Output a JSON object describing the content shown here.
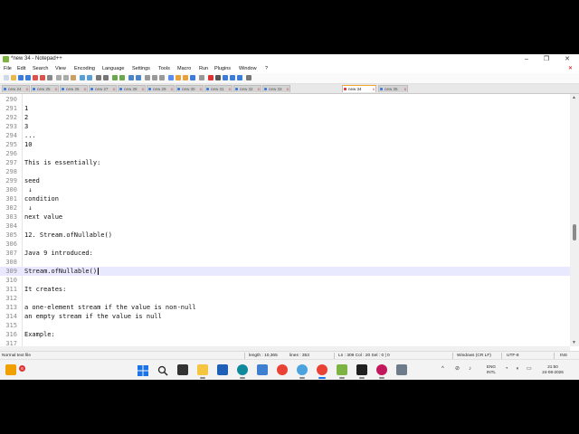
{
  "window": {
    "title": "*new 34 - Notepad++",
    "buttons": [
      "–",
      "❐",
      "✕"
    ]
  },
  "menu": [
    "File",
    "Edit",
    "Search",
    "View",
    "Encoding",
    "Language",
    "Settings",
    "Tools",
    "Macro",
    "Run",
    "Plugins",
    "Window",
    "?"
  ],
  "tabs": [
    {
      "label": "new 24",
      "active": false
    },
    {
      "label": "new 25",
      "active": false
    },
    {
      "label": "new 26",
      "active": false
    },
    {
      "label": "new 27",
      "active": false
    },
    {
      "label": "new 28",
      "active": false
    },
    {
      "label": "new 29",
      "active": false
    },
    {
      "label": "new 30",
      "active": false
    },
    {
      "label": "new 31",
      "active": false
    },
    {
      "label": "new 32",
      "active": false
    },
    {
      "label": "new 33",
      "active": false
    },
    {
      "label": "new 34",
      "active": true
    },
    {
      "label": "new 35",
      "active": false
    }
  ],
  "editor": {
    "current_line": 309,
    "lines": [
      {
        "n": "290",
        "text": ""
      },
      {
        "n": "291",
        "text": "1"
      },
      {
        "n": "292",
        "text": "2"
      },
      {
        "n": "293",
        "text": "3"
      },
      {
        "n": "294",
        "text": "..."
      },
      {
        "n": "295",
        "text": "10"
      },
      {
        "n": "296",
        "text": ""
      },
      {
        "n": "297",
        "text": "This is essentially:"
      },
      {
        "n": "298",
        "text": ""
      },
      {
        "n": "299",
        "text": "seed"
      },
      {
        "n": "300",
        "text": " ↓"
      },
      {
        "n": "301",
        "text": "condition"
      },
      {
        "n": "302",
        "text": " ↓"
      },
      {
        "n": "303",
        "text": "next value"
      },
      {
        "n": "304",
        "text": ""
      },
      {
        "n": "305",
        "text": "12. Stream.ofNullable()"
      },
      {
        "n": "306",
        "text": ""
      },
      {
        "n": "307",
        "text": "Java 9 introduced:"
      },
      {
        "n": "308",
        "text": ""
      },
      {
        "n": "309",
        "text": "Stream.ofNullable()"
      },
      {
        "n": "310",
        "text": ""
      },
      {
        "n": "311",
        "text": "It creates:"
      },
      {
        "n": "312",
        "text": ""
      },
      {
        "n": "313",
        "text": "a one-element stream if the value is non-null"
      },
      {
        "n": "314",
        "text": "an empty stream if the value is null"
      },
      {
        "n": "315",
        "text": ""
      },
      {
        "n": "316",
        "text": "Example:"
      },
      {
        "n": "317",
        "text": ""
      }
    ]
  },
  "status": {
    "filetype": "Normal text file",
    "length": "length : 10,365",
    "lines": "lines : 353",
    "position": "Ln : 309    Col : 20    Sel : 0 | 0",
    "eol": "Windows (CR LF)",
    "encoding": "UTF-8",
    "mode": "INS"
  },
  "taskbar": {
    "notification_count": "6",
    "language_top": "ENG",
    "language_bottom": "INTL",
    "time": "21:50",
    "date": "24-08-2026"
  },
  "colors": {
    "accent": "#1a73e8",
    "tab_active_border": "#f2a630",
    "current_line_bg": "#e8e8ff"
  }
}
